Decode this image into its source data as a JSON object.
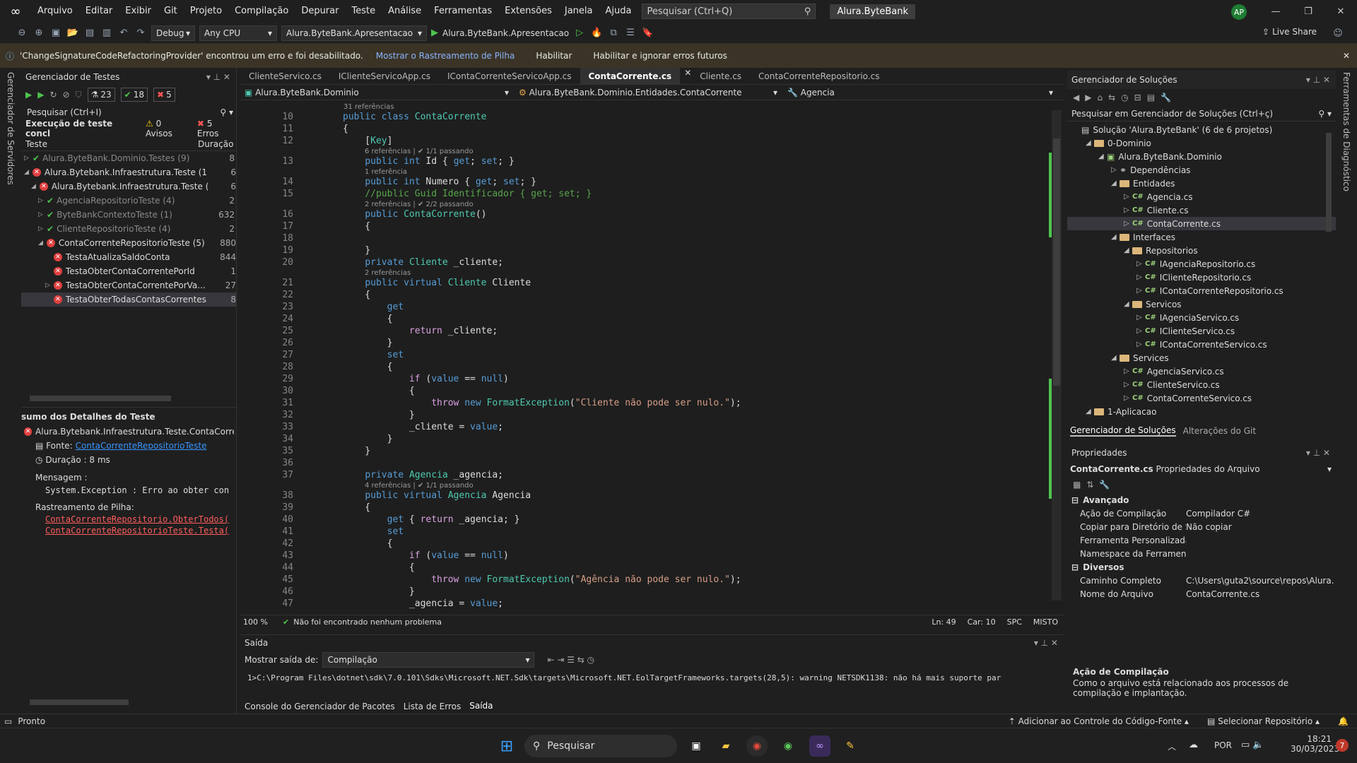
{
  "menubar": {
    "items": [
      "Arquivo",
      "Editar",
      "Exibir",
      "Git",
      "Projeto",
      "Compilação",
      "Depurar",
      "Teste",
      "Análise",
      "Ferramentas",
      "Extensões",
      "Janela",
      "Ajuda"
    ],
    "search_placeholder": "Pesquisar (Ctrl+Q)",
    "solution_name": "Alura.ByteBank",
    "avatar": "AP"
  },
  "toolbar": {
    "config": "Debug",
    "platform": "Any CPU",
    "startup_project": "Alura.ByteBank.Apresentacao",
    "run_label": "Alura.ByteBank.Apresentacao",
    "live_share": "Live Share"
  },
  "infobar": {
    "message": "'ChangeSignatureCodeRefactoringProvider' encontrou um erro e foi desabilitado.",
    "link": "Mostrar o Rastreamento de Pilha",
    "enable": "Habilitar",
    "enable_ignore": "Habilitar e ignorar erros futuros"
  },
  "leftrail": {
    "label": "Gerenciador de Servidores"
  },
  "rightrail": {
    "label": "Ferramentas de Diagnóstico"
  },
  "test_explorer": {
    "title": "Gerenciador de Testes",
    "count_total": "23",
    "count_passed": "18",
    "count_failed": "5",
    "search": "Pesquisar (Ctrl+I)",
    "run_summary": "Execução de teste concl",
    "warnings": "0 Avisos",
    "errors": "5 Erros",
    "col_test": "Teste",
    "col_duration": "Duração",
    "rows": [
      {
        "label": "Alura.ByteBank.Dominio.Testes (9)",
        "dur": "8",
        "status": "ok",
        "indent": 0,
        "exp": "▷",
        "dim": true
      },
      {
        "label": "Alura.Bytebank.Infraestrutura.Teste (1...",
        "dur": "6",
        "status": "fail",
        "indent": 0,
        "exp": "◢",
        "dim": false
      },
      {
        "label": "Alura.Bytebank.Infraestrutura.Teste (...",
        "dur": "6",
        "status": "fail",
        "indent": 1,
        "exp": "◢",
        "dim": false
      },
      {
        "label": "AgenciaRepositorioTeste (4)",
        "dur": "2",
        "status": "ok",
        "indent": 2,
        "exp": "▷",
        "dim": true
      },
      {
        "label": "ByteBankContextoTeste (1)",
        "dur": "632",
        "status": "ok",
        "indent": 2,
        "exp": "▷",
        "dim": true
      },
      {
        "label": "ClienteRepositorioTeste (4)",
        "dur": "2",
        "status": "ok",
        "indent": 2,
        "exp": "▷",
        "dim": true
      },
      {
        "label": "ContaCorrenteRepositorioTeste (5)",
        "dur": "880",
        "status": "fail",
        "indent": 2,
        "exp": "◢",
        "dim": false
      },
      {
        "label": "TestaAtualizaSaldoConta",
        "dur": "844",
        "status": "fail",
        "indent": 3,
        "exp": "",
        "dim": false
      },
      {
        "label": "TestaObterContaCorrentePorId",
        "dur": "1",
        "status": "fail",
        "indent": 3,
        "exp": "",
        "dim": false
      },
      {
        "label": "TestaObterContaCorrentePorVa...",
        "dur": "27",
        "status": "fail",
        "indent": 3,
        "exp": "▷",
        "dim": false
      },
      {
        "label": "TestaObterTodasContasCorrentes",
        "dur": "8",
        "status": "fail",
        "indent": 3,
        "exp": "",
        "dim": false,
        "selected": true
      }
    ],
    "details": {
      "title": "sumo dos Detalhes do Teste",
      "test_name": "Alura.Bytebank.Infraestrutura.Teste.ContaCorrente",
      "source_label": "Fonte:",
      "source_link": "ContaCorrenteRepositorioTeste",
      "duration": "Duração : 8 ms",
      "message_label": "Mensagem :",
      "message": "System.Exception : Erro ao obter con",
      "stack_label": "Rastreamento de Pilha:",
      "stack": [
        "ContaCorrenteRepositorio.ObterTodos(",
        "ContaCorrenteRepositorioTeste.Testa("
      ]
    }
  },
  "editor": {
    "tabs": [
      "ClienteServico.cs",
      "IClienteServicoApp.cs",
      "IContaCorrenteServicoApp.cs",
      "ContaCorrente.cs",
      "Cliente.cs",
      "ContaCorrenteRepositorio.cs"
    ],
    "active_tab": "ContaCorrente.cs",
    "nav_project": "Alura.ByteBank.Dominio",
    "nav_type": "Alura.ByteBank.Dominio.Entidades.ContaCorrente",
    "nav_member": "Agencia",
    "zoom": "100 %",
    "issues": "Não foi encontrado nenhum problema",
    "ln": "Ln: 49",
    "col": "Car: 10",
    "spc": "SPC",
    "eol": "MISTO"
  },
  "code_lines": [
    {
      "n": "",
      "lens": "31 referências"
    },
    {
      "n": "10",
      "html": "<span class='kw'>public class</span> <span class='ty'>ContaCorrente</span>"
    },
    {
      "n": "11",
      "html": "{"
    },
    {
      "n": "12",
      "html": "    [<span class='ty'>Key</span>]"
    },
    {
      "n": "",
      "lens": "6 referências | ✔ 1/1 passando",
      "indent": 1
    },
    {
      "n": "13",
      "html": "    <span class='kw'>public int</span> Id { <span class='kw'>get</span>; <span class='kw'>set</span>; }"
    },
    {
      "n": "",
      "lens": "1 referência",
      "indent": 1
    },
    {
      "n": "14",
      "html": "    <span class='kw'>public int</span> Numero { <span class='kw'>get</span>; <span class='kw'>set</span>; }"
    },
    {
      "n": "15",
      "html": "    <span class='cm'>//public Guid Identificador { get; set; }</span>"
    },
    {
      "n": "",
      "lens": "2 referências | ✔ 2/2 passando",
      "indent": 1
    },
    {
      "n": "16",
      "html": "    <span class='kw'>public</span> <span class='ty'>ContaCorrente</span>()"
    },
    {
      "n": "17",
      "html": "    {"
    },
    {
      "n": "18",
      "html": ""
    },
    {
      "n": "19",
      "html": "    }"
    },
    {
      "n": "20",
      "html": "    <span class='kw'>private</span> <span class='ty'>Cliente</span> _cliente;"
    },
    {
      "n": "",
      "lens": "2 referências",
      "indent": 1
    },
    {
      "n": "21",
      "html": "    <span class='kw'>public virtual</span> <span class='ty'>Cliente</span> Cliente"
    },
    {
      "n": "22",
      "html": "    {"
    },
    {
      "n": "23",
      "html": "        <span class='kw'>get</span>"
    },
    {
      "n": "24",
      "html": "        {"
    },
    {
      "n": "25",
      "html": "            <span class='kw2'>return</span> _cliente;"
    },
    {
      "n": "26",
      "html": "        }"
    },
    {
      "n": "27",
      "html": "        <span class='kw'>set</span>"
    },
    {
      "n": "28",
      "html": "        {"
    },
    {
      "n": "29",
      "html": "            <span class='kw2'>if</span> (<span class='kw'>value</span> == <span class='kw'>null</span>)"
    },
    {
      "n": "30",
      "html": "            {"
    },
    {
      "n": "31",
      "html": "                <span class='kw2'>throw</span> <span class='kw'>new</span> <span class='ty'>FormatException</span>(<span class='st'>\"Cliente não pode ser nulo.\"</span>);"
    },
    {
      "n": "32",
      "html": "            }"
    },
    {
      "n": "33",
      "html": "            _cliente = <span class='kw'>value</span>;"
    },
    {
      "n": "34",
      "html": "        }"
    },
    {
      "n": "35",
      "html": "    }"
    },
    {
      "n": "36",
      "html": ""
    },
    {
      "n": "37",
      "html": "    <span class='kw'>private</span> <span class='ty'>Agencia</span> _agencia;"
    },
    {
      "n": "",
      "lens": "4 referências | ✔ 1/1 passando",
      "indent": 1
    },
    {
      "n": "38",
      "html": "    <span class='kw'>public virtual</span> <span class='ty'>Agencia</span> Agencia"
    },
    {
      "n": "39",
      "html": "    {"
    },
    {
      "n": "40",
      "html": "        <span class='kw'>get</span> { <span class='kw2'>return</span> _agencia; }"
    },
    {
      "n": "41",
      "html": "        <span class='kw'>set</span>"
    },
    {
      "n": "42",
      "html": "        {"
    },
    {
      "n": "43",
      "html": "            <span class='kw2'>if</span> (<span class='kw'>value</span> == <span class='kw'>null</span>)"
    },
    {
      "n": "44",
      "html": "            {"
    },
    {
      "n": "45",
      "html": "                <span class='kw2'>throw</span> <span class='kw'>new</span> <span class='ty'>FormatException</span>(<span class='st'>\"Agência não pode ser nulo.\"</span>);"
    },
    {
      "n": "46",
      "html": "            }"
    },
    {
      "n": "47",
      "html": "            _agencia = <span class='kw'>value</span>;"
    }
  ],
  "output": {
    "title": "Saída",
    "show_label": "Mostrar saída de:",
    "source": "Compilação",
    "line": "1>C:\\Program Files\\dotnet\\sdk\\7.0.101\\Sdks\\Microsoft.NET.Sdk\\targets\\Microsoft.NET.EolTargetFrameworks.targets(28,5): warning NETSDK1138: não há mais suporte par",
    "tabs": [
      "Console do Gerenciador de Pacotes",
      "Lista de Erros",
      "Saída"
    ]
  },
  "solution_explorer": {
    "title": "Gerenciador de Soluções",
    "search": "Pesquisar em Gerenciador de Soluções (Ctrl+ç)",
    "rows": [
      {
        "label": "Solução 'Alura.ByteBank' (6 de 6 projetos)",
        "indent": 0,
        "kind": "solution",
        "exp": ""
      },
      {
        "label": "0-Dominio",
        "indent": 1,
        "kind": "folder",
        "exp": "◢"
      },
      {
        "label": "Alura.ByteBank.Dominio",
        "indent": 2,
        "kind": "project",
        "exp": "◢"
      },
      {
        "label": "Dependências",
        "indent": 3,
        "kind": "deps",
        "exp": "▷"
      },
      {
        "label": "Entidades",
        "indent": 3,
        "kind": "folder",
        "exp": "◢"
      },
      {
        "label": "Agencia.cs",
        "indent": 4,
        "kind": "cs",
        "exp": "▷"
      },
      {
        "label": "Cliente.cs",
        "indent": 4,
        "kind": "cs",
        "exp": "▷"
      },
      {
        "label": "ContaCorrente.cs",
        "indent": 4,
        "kind": "cs",
        "exp": "▷",
        "selected": true
      },
      {
        "label": "Interfaces",
        "indent": 3,
        "kind": "folder",
        "exp": "◢"
      },
      {
        "label": "Repositorios",
        "indent": 4,
        "kind": "folder",
        "exp": "◢"
      },
      {
        "label": "IAgenciaRepositorio.cs",
        "indent": 5,
        "kind": "cs",
        "exp": "▷"
      },
      {
        "label": "IClienteRepositorio.cs",
        "indent": 5,
        "kind": "cs",
        "exp": "▷"
      },
      {
        "label": "IContaCorrenteRepositorio.cs",
        "indent": 5,
        "kind": "cs",
        "exp": "▷"
      },
      {
        "label": "Servicos",
        "indent": 4,
        "kind": "folder",
        "exp": "◢"
      },
      {
        "label": "IAgenciaServico.cs",
        "indent": 5,
        "kind": "cs",
        "exp": "▷"
      },
      {
        "label": "IClienteServico.cs",
        "indent": 5,
        "kind": "cs",
        "exp": "▷"
      },
      {
        "label": "IContaCorrenteServico.cs",
        "indent": 5,
        "kind": "cs",
        "exp": "▷"
      },
      {
        "label": "Services",
        "indent": 3,
        "kind": "folder",
        "exp": "◢"
      },
      {
        "label": "AgenciaServico.cs",
        "indent": 4,
        "kind": "cs",
        "exp": "▷"
      },
      {
        "label": "ClienteServico.cs",
        "indent": 4,
        "kind": "cs",
        "exp": "▷"
      },
      {
        "label": "ContaCorrenteServico.cs",
        "indent": 4,
        "kind": "cs",
        "exp": "▷"
      },
      {
        "label": "1-Aplicacao",
        "indent": 1,
        "kind": "folder",
        "exp": "◢"
      }
    ],
    "bottom_tabs": [
      "Gerenciador de Soluções",
      "Alterações do Git"
    ]
  },
  "properties": {
    "title": "Propriedades",
    "file": "ContaCorrente.cs",
    "file_kind": "Propriedades do Arquivo",
    "sections": [
      {
        "name": "Avançado",
        "rows": [
          [
            "Ação de Compilação",
            "Compilador C#"
          ],
          [
            "Copiar para Diretório de Saída",
            "Não copiar"
          ],
          [
            "Ferramenta Personalizada",
            ""
          ],
          [
            "Namespace da Ferramenta Pers",
            ""
          ]
        ]
      },
      {
        "name": "Diversos",
        "rows": [
          [
            "Caminho Completo",
            "C:\\Users\\guta2\\source\\repos\\Alura."
          ],
          [
            "Nome do Arquivo",
            "ContaCorrente.cs"
          ]
        ]
      }
    ],
    "desc_title": "Ação de Compilação",
    "desc_text": "Como o arquivo está relacionado aos processos de compilação e implantação."
  },
  "statusbar": {
    "ready": "Pronto",
    "source_control": "Adicionar ao Controle do Código-Fonte",
    "repo": "Selecionar Repositório"
  },
  "taskbar": {
    "search": "Pesquisar",
    "lang": "POR",
    "time": "18:21",
    "date": "30/03/2023",
    "notif": "7"
  }
}
